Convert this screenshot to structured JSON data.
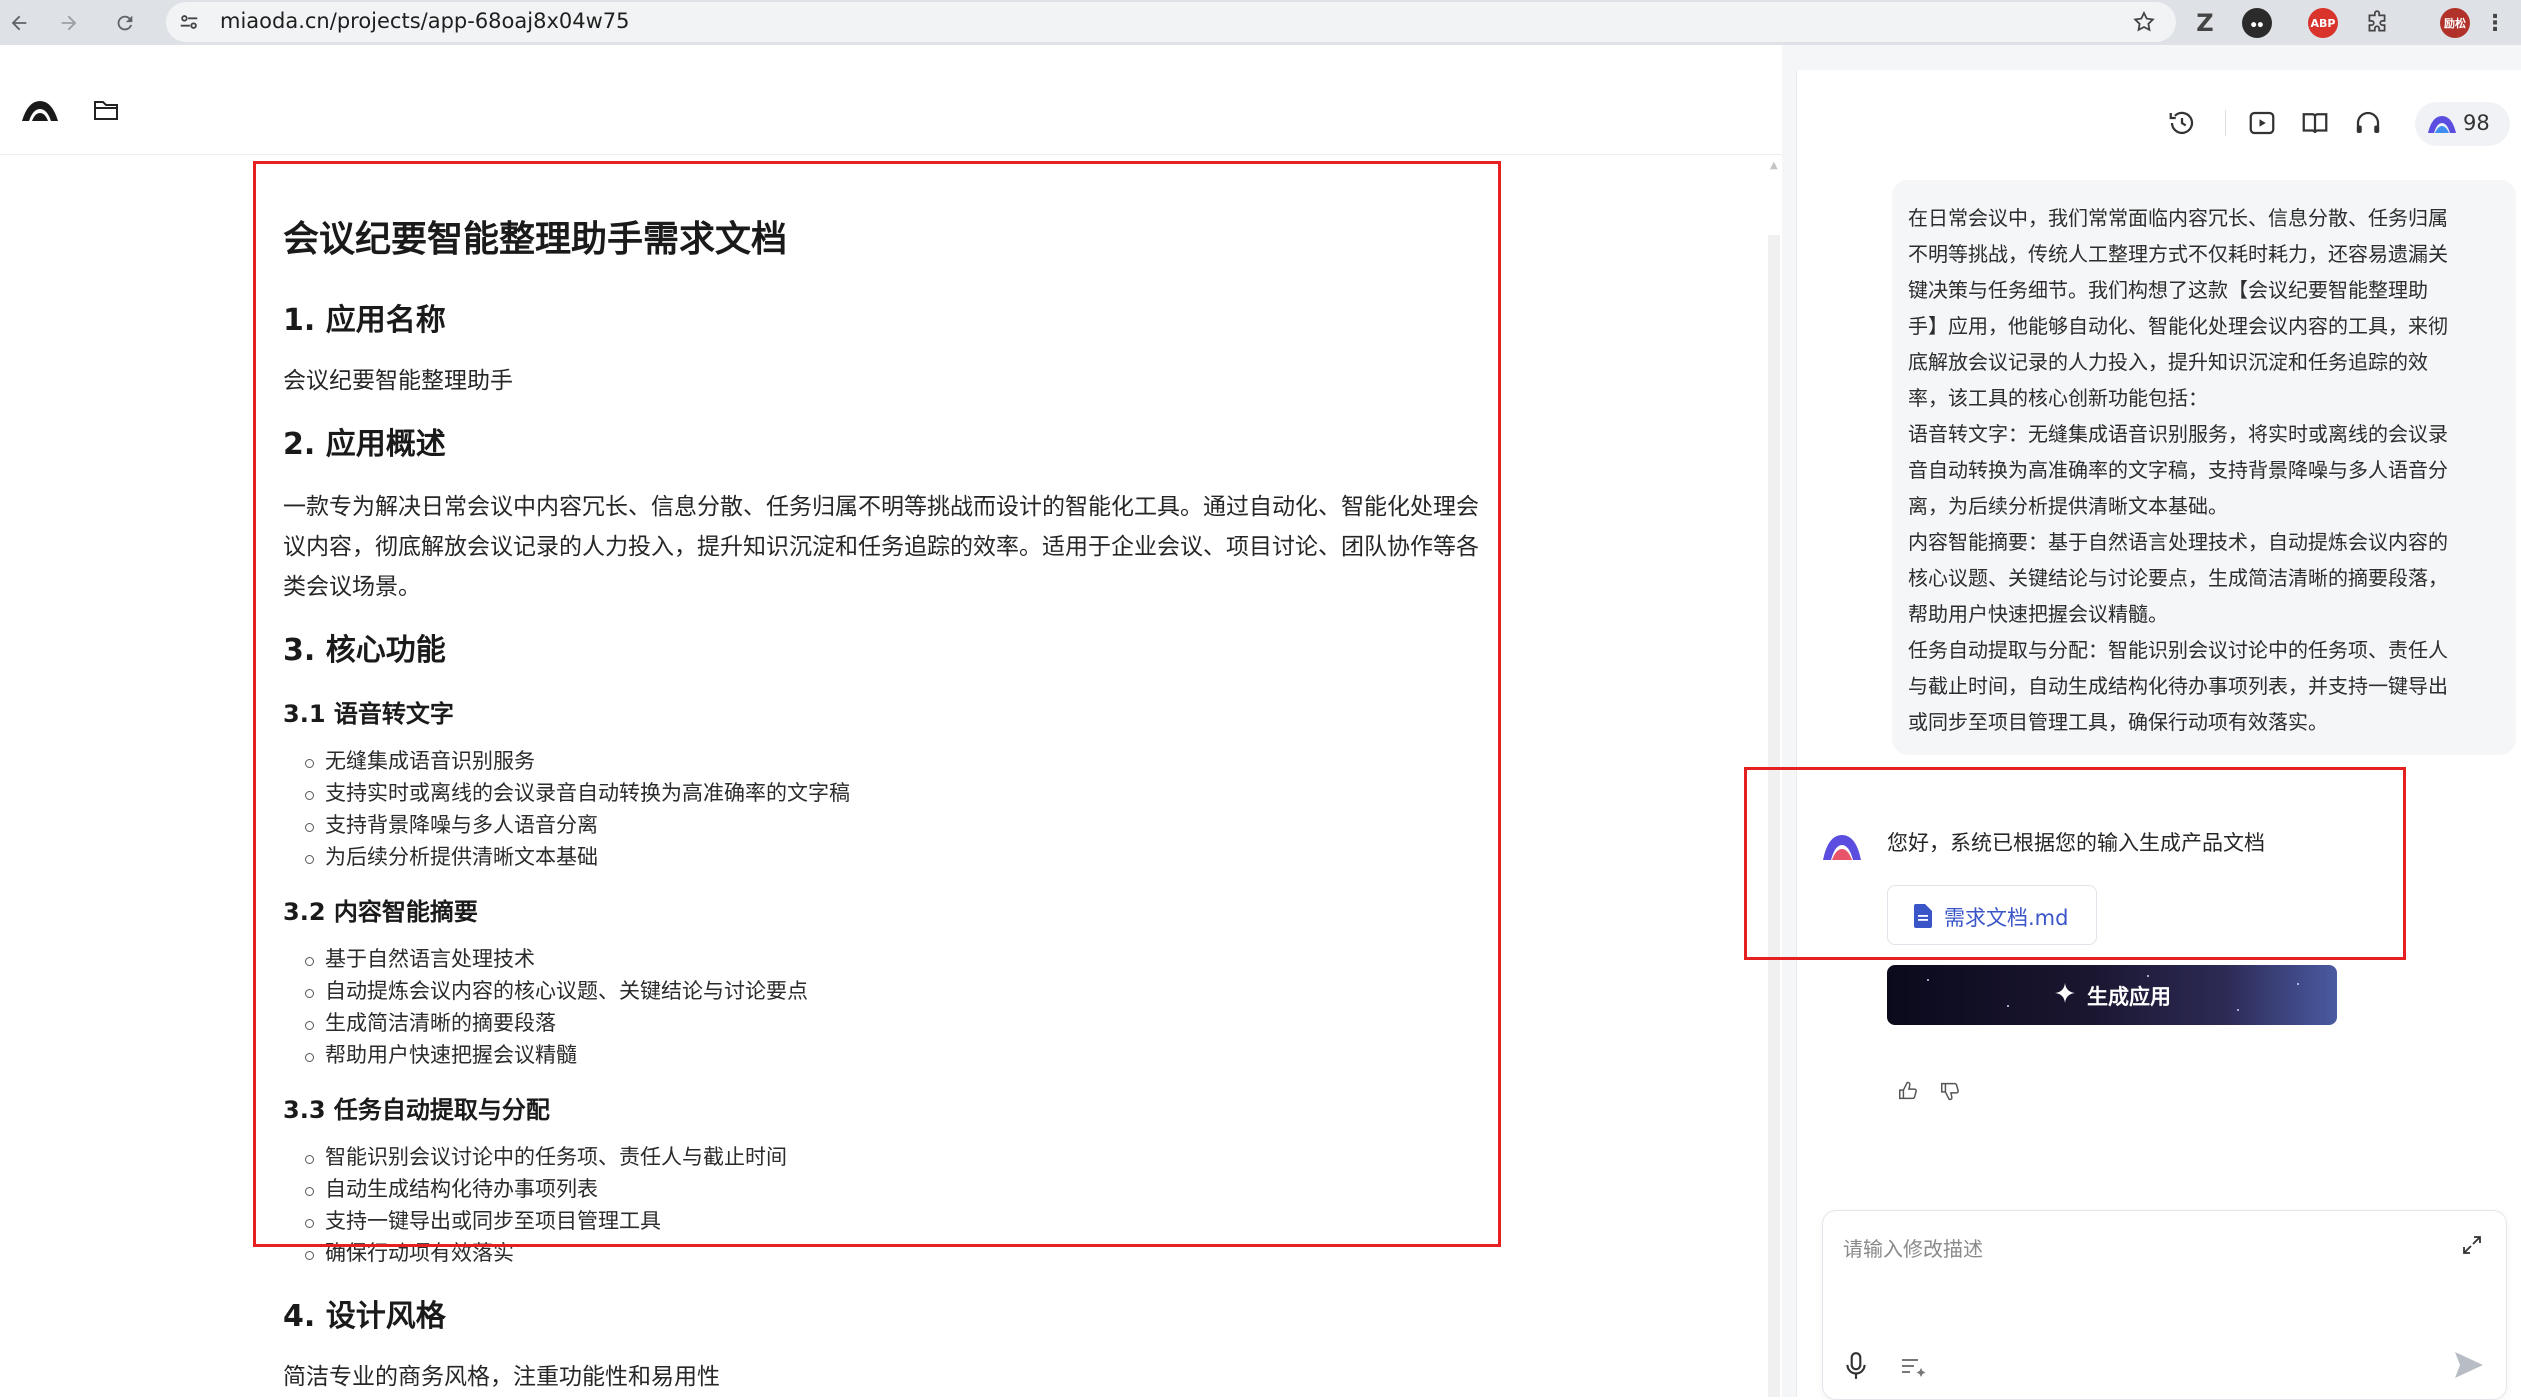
{
  "browser": {
    "url": "miaoda.cn/projects/app-68oaj8x04w75",
    "ext_abp": "ABP",
    "ext_profile": "励松"
  },
  "document": {
    "title": "会议纪要智能整理助手需求文档",
    "s1_heading": "1. 应用名称",
    "s1_text": "会议纪要智能整理助手",
    "s2_heading": "2. 应用概述",
    "s2_text": "一款专为解决日常会议中内容冗长、信息分散、任务归属不明等挑战而设计的智能化工具。通过自动化、智能化处理会议内容，彻底解放会议记录的人力投入，提升知识沉淀和任务追踪的效率。适用于企业会议、项目讨论、团队协作等各类会议场景。",
    "s3_heading": "3. 核心功能",
    "s31_heading": "3.1 语音转文字",
    "s31_items": [
      "无缝集成语音识别服务",
      "支持实时或离线的会议录音自动转换为高准确率的文字稿",
      "支持背景降噪与多人语音分离",
      "为后续分析提供清晰文本基础"
    ],
    "s32_heading": "3.2 内容智能摘要",
    "s32_items": [
      "基于自然语言处理技术",
      "自动提炼会议内容的核心议题、关键结论与讨论要点",
      "生成简洁清晰的摘要段落",
      "帮助用户快速把握会议精髓"
    ],
    "s33_heading": "3.3 任务自动提取与分配",
    "s33_items": [
      "智能识别会议讨论中的任务项、责任人与截止时间",
      "自动生成结构化待办事项列表",
      "支持一键导出或同步至项目管理工具",
      "确保行动项有效落实"
    ],
    "s4_heading": "4. 设计风格",
    "s4_text": "简洁专业的商务风格，注重功能性和易用性"
  },
  "chat": {
    "credits": "98",
    "user_message_lines": [
      "在日常会议中，我们常常面临内容冗长、信息分散、任务归属",
      "不明等挑战，传统人工整理方式不仅耗时耗力，还容易遗漏关",
      "键决策与任务细节。我们构想了这款【会议纪要智能整理助",
      "手】应用，他能够自动化、智能化处理会议内容的工具，来彻",
      "底解放会议记录的人力投入，提升知识沉淀和任务追踪的效",
      "率，该工具的核心创新功能包括：",
      "语音转文字：无缝集成语音识别服务，将实时或离线的会议录",
      "音自动转换为高准确率的文字稿，支持背景降噪与多人语音分",
      "离，为后续分析提供清晰文本基础。",
      "内容智能摘要：基于自然语言处理技术，自动提炼会议内容的",
      "核心议题、关键结论与讨论要点，生成简洁清晰的摘要段落，",
      "帮助用户快速把握会议精髓。",
      "任务自动提取与分配：智能识别会议讨论中的任务项、责任人",
      "与截止时间，自动生成结构化待办事项列表，并支持一键导出",
      "或同步至项目管理工具，确保行动项有效落实。"
    ],
    "ai_message": "您好，系统已根据您的输入生成产品文档",
    "file_name": "需求文档.md",
    "generate_label": "生成应用",
    "input_placeholder": "请输入修改描述"
  },
  "colors": {
    "annotation_red": "#e52020",
    "link_blue": "#3a55c8",
    "brand_purple": "#5b4de0"
  }
}
